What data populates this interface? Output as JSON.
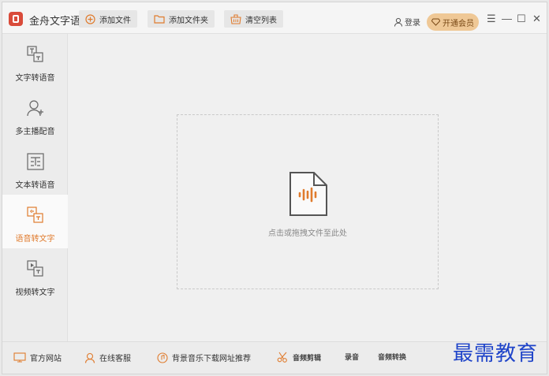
{
  "app": {
    "title": "金舟文字语音转换软件"
  },
  "header": {
    "login_label": "登录",
    "vip_label": "开通会员"
  },
  "sidebar": {
    "items": [
      {
        "label": "文字转语音",
        "icon": "text-to-speech-icon"
      },
      {
        "label": "多主播配音",
        "icon": "multi-anchor-icon"
      },
      {
        "label": "文本转语音",
        "icon": "document-to-speech-icon"
      },
      {
        "label": "语音转文字",
        "icon": "speech-to-text-icon",
        "active": true
      },
      {
        "label": "视频转文字",
        "icon": "video-to-text-icon"
      }
    ]
  },
  "toolbar": {
    "add_file": "添加文件",
    "add_folder": "添加文件夹",
    "clear_list": "清空列表"
  },
  "dropzone": {
    "hint": "点击或拖拽文件至此处"
  },
  "bottombar": {
    "website": "官方网站",
    "support": "在线客服",
    "music": "背景音乐下载网址推荐",
    "audio_cut": "音频剪辑",
    "record": "录音",
    "audio_convert": "音频转换"
  },
  "watermark": "最需教育",
  "colors": {
    "accent": "#e07b2d",
    "vip_bg": "#efc896",
    "logo": "#d94b3a",
    "watermark": "#1f44c9"
  }
}
